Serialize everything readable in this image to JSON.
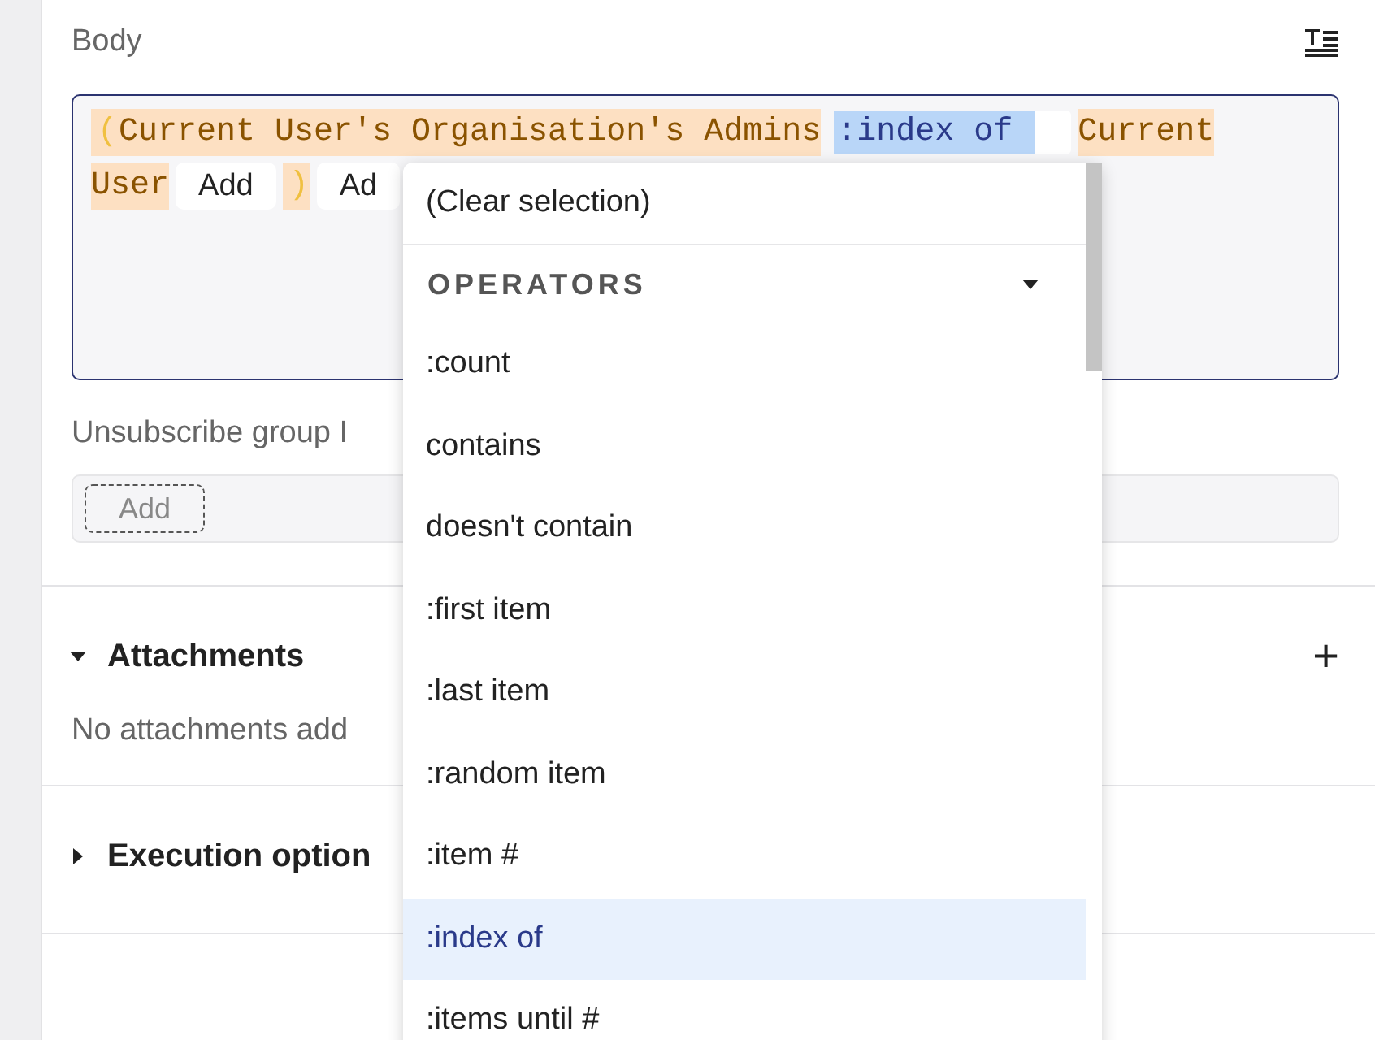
{
  "body": {
    "label": "Body",
    "lines": [
      [
        {
          "kind": "paren",
          "text": "("
        },
        {
          "kind": "variable",
          "text": "Current User's Organisation's Admins"
        },
        {
          "kind": "operator",
          "text": ":index of",
          "selected": true
        },
        {
          "kind": "variable",
          "text": "Current"
        }
      ],
      [
        {
          "kind": "variable",
          "text": "User"
        },
        {
          "kind": "add",
          "text": "Add"
        },
        {
          "kind": "paren",
          "text": ")"
        },
        {
          "kind": "add",
          "text": "Ad"
        }
      ]
    ]
  },
  "unsubscribe": {
    "label": "Unsubscribe group I",
    "add": "Add"
  },
  "sections": [
    {
      "title": "Attachments",
      "expanded": true,
      "text": "No attachments add",
      "action": "+"
    },
    {
      "title": "Execution option",
      "expanded": false
    }
  ],
  "dropdown": {
    "clear": "(Clear selection)",
    "group": {
      "title": "OPERATORS",
      "expanded": true
    },
    "items": [
      {
        "label": ":count",
        "selected": false
      },
      {
        "label": "contains",
        "selected": false
      },
      {
        "label": "doesn't contain",
        "selected": false
      },
      {
        "label": ":first item",
        "selected": false
      },
      {
        "label": ":last item",
        "selected": false
      },
      {
        "label": ":random item",
        "selected": false
      },
      {
        "label": ":item #",
        "selected": false
      },
      {
        "label": ":index of",
        "selected": true
      },
      {
        "label": ":items until #",
        "selected": false
      }
    ]
  }
}
